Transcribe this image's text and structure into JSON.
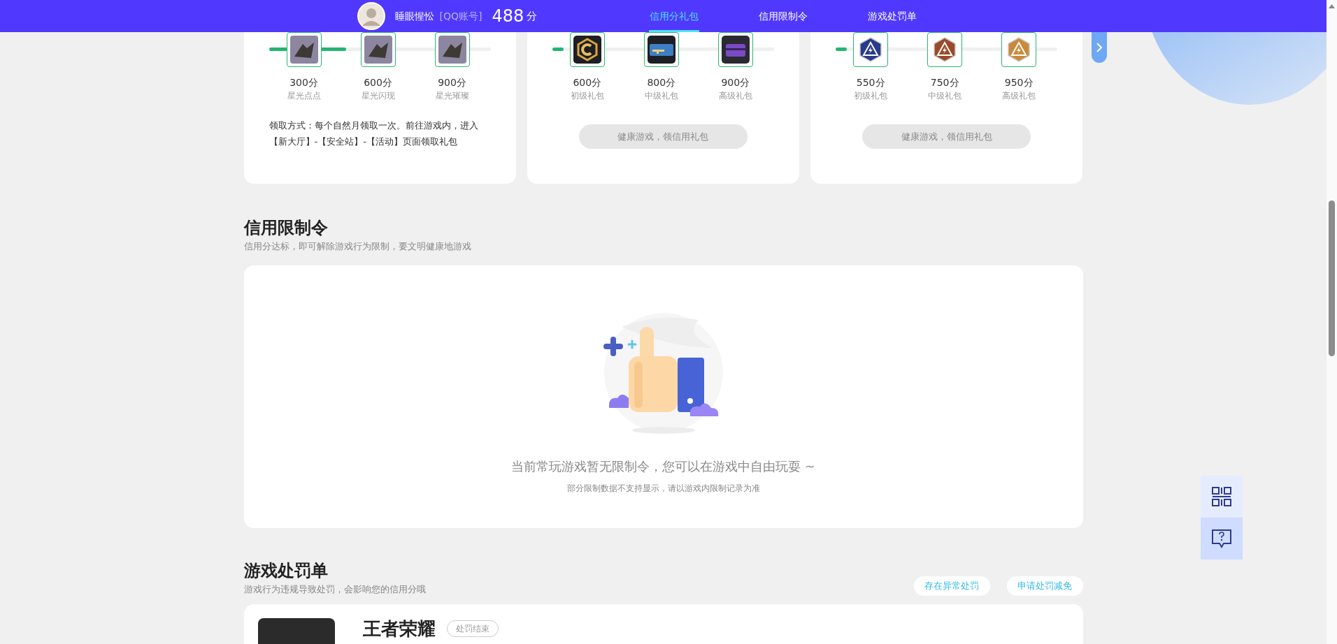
{
  "nav": {
    "user": {
      "name": "睡眼惺忪",
      "account_type": "[QQ账号]",
      "score": "488",
      "score_unit": "分"
    },
    "tabs": [
      {
        "label": "信用分礼包",
        "selected": true
      },
      {
        "label": "信用限制令",
        "selected": false
      },
      {
        "label": "游戏处罚单",
        "selected": false
      }
    ]
  },
  "gift_cards": [
    {
      "level": 0.35,
      "rewards": [
        {
          "kind": "photo",
          "points": "300分",
          "name": "星光点点"
        },
        {
          "kind": "photo",
          "points": "600分",
          "name": "星光闪现"
        },
        {
          "kind": "photo",
          "points": "900分",
          "name": "星光璀璨"
        }
      ],
      "note": "领取方式：每个自然月领取一次。前往游戏内，进入【新大厅】-【安全站】-【活动】页面领取礼包"
    },
    {
      "level": 0.05,
      "rewards": [
        {
          "kind": "hex-badge",
          "points": "600分",
          "name": "初级礼包"
        },
        {
          "kind": "gun-card",
          "points": "800分",
          "name": "中级礼包"
        },
        {
          "kind": "crate",
          "points": "900分",
          "name": "高级礼包"
        }
      ],
      "button": {
        "label": "健康游戏，领信用礼包",
        "disabled": true
      }
    },
    {
      "level": 0.05,
      "rewards": [
        {
          "kind": "emblem",
          "color": "#2a3a8c",
          "points": "550分",
          "name": "初级礼包"
        },
        {
          "kind": "emblem",
          "color": "#9a4a2a",
          "points": "750分",
          "name": "中级礼包"
        },
        {
          "kind": "emblem",
          "color": "#c98a3a",
          "points": "950分",
          "name": "高级礼包"
        }
      ],
      "button": {
        "label": "健康游戏，领信用礼包",
        "disabled": true
      }
    }
  ],
  "restriction": {
    "title": "信用限制令",
    "subtitle": "信用分达标，即可解除游戏行为限制，要文明健康地游戏",
    "empty_text": "当前常玩游戏暂无限制令，您可以在游戏中自由玩耍 ~",
    "empty_note": "部分限制数据不支持显示，请以游戏内限制记录为准"
  },
  "penalty": {
    "title": "游戏处罚单",
    "subtitle": "游戏行为违规导致处罚，会影响您的信用分哦",
    "actions": [
      "存在异常处罚",
      "申请处罚减免"
    ],
    "records": [
      {
        "game": "王者荣耀",
        "status": "处罚结束"
      }
    ]
  }
}
